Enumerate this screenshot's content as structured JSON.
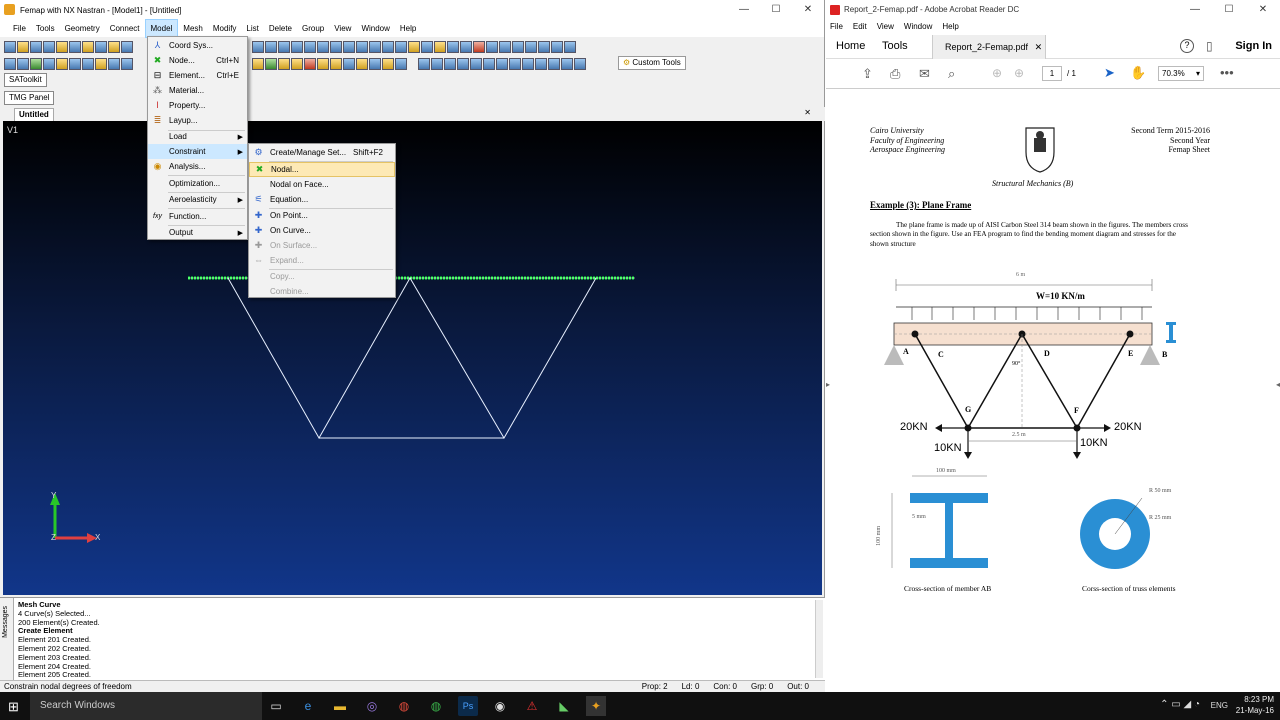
{
  "femap": {
    "title": "Femap with NX Nastran - [Model1] - [Untitled]",
    "menu": [
      "File",
      "Tools",
      "Geometry",
      "Connect",
      "Model",
      "Mesh",
      "Modify",
      "List",
      "Delete",
      "Group",
      "View",
      "Window",
      "Help"
    ],
    "panels": {
      "satoolkit": "SAToolkit",
      "tmg": "TMG Panel",
      "custom_tools": "Custom Tools"
    },
    "tab": "Untitled",
    "view_label": "V1",
    "model_menu": [
      {
        "label": "Coord Sys...",
        "shortcut": "",
        "icon": "coord-sys-icon"
      },
      {
        "label": "Node...",
        "shortcut": "Ctrl+N",
        "icon": "node-icon"
      },
      {
        "label": "Element...",
        "shortcut": "Ctrl+E",
        "icon": "element-icon"
      },
      {
        "label": "Material...",
        "shortcut": "",
        "icon": "material-icon"
      },
      {
        "label": "Property...",
        "shortcut": "",
        "icon": "property-icon"
      },
      {
        "label": "Layup...",
        "shortcut": "",
        "icon": "layup-icon"
      },
      {
        "label": "Load",
        "shortcut": "",
        "icon": ""
      },
      {
        "label": "Constraint",
        "shortcut": "",
        "icon": ""
      },
      {
        "label": "Analysis...",
        "shortcut": "",
        "icon": "analysis-icon"
      },
      {
        "label": "Optimization...",
        "shortcut": "",
        "icon": ""
      },
      {
        "label": "Aeroelasticity",
        "shortcut": "",
        "icon": ""
      },
      {
        "label": "Function...",
        "shortcut": "",
        "icon": "function-icon"
      },
      {
        "label": "Output",
        "shortcut": "",
        "icon": ""
      }
    ],
    "constraint_menu": [
      {
        "label": "Create/Manage Set...",
        "shortcut": "Shift+F2"
      },
      {
        "label": "Nodal...",
        "shortcut": ""
      },
      {
        "label": "Nodal on Face...",
        "shortcut": ""
      },
      {
        "label": "Equation...",
        "shortcut": ""
      },
      {
        "label": "On Point...",
        "shortcut": ""
      },
      {
        "label": "On Curve...",
        "shortcut": ""
      },
      {
        "label": "On Surface...",
        "shortcut": ""
      },
      {
        "label": "Expand...",
        "shortcut": ""
      },
      {
        "label": "Copy...",
        "shortcut": ""
      },
      {
        "label": "Combine...",
        "shortcut": ""
      }
    ],
    "messages_tab": "Messages",
    "messages": [
      "Mesh Curve",
      "4 Curve(s) Selected...",
      "200 Element(s) Created.",
      "Create Element",
      "Element 201 Created.",
      "Element 202 Created.",
      "Element 203 Created.",
      "Element 204 Created.",
      "Element 205 Created."
    ],
    "status": {
      "hint": "Constrain nodal degrees of freedom",
      "prop": "Prop: 2",
      "ld": "Ld: 0",
      "con": "Con: 0",
      "grp": "Grp: 0",
      "out": "Out: 0"
    },
    "axis": {
      "y": "Y",
      "x": "X",
      "z": "Z"
    }
  },
  "acrobat": {
    "title": "Report_2-Femap.pdf - Adobe Acrobat Reader DC",
    "menu": [
      "File",
      "Edit",
      "View",
      "Window",
      "Help"
    ],
    "home": "Home",
    "tools": "Tools",
    "doc_tab": "Report_2-Femap.pdf",
    "sign_in": "Sign In",
    "page_num": "1",
    "page_of": "/ 1",
    "zoom": "70.3%",
    "page": {
      "left_header": [
        "Cairo University",
        "Faculty of Engineering",
        "Aerospace Engineering"
      ],
      "right_header": [
        "Second Term 2015-2016",
        "Second Year",
        "Femap Sheet"
      ],
      "subtitle": "Structural   Mechanics   (B)",
      "example_title": "Example (3): Plane Frame",
      "paragraph": "The plane frame is made up of AISI Carbon Steel 314 beam shown in the figures. The members cross section shown in the figure. Use an FEA program to find the bending moment diagram and stresses for the shown structure",
      "dim_6m": "6 m",
      "load": "W=10 KN/m",
      "labels": {
        "A": "A",
        "B": "B",
        "C": "C",
        "D": "D",
        "E": "E",
        "F": "F",
        "G": "G"
      },
      "angle": "90°",
      "f20_left": "20KN",
      "f20_right": "20KN",
      "f10_left": "10KN",
      "f10_right": "10KN",
      "dim_25": "2.5 m",
      "i_width": "100 mm",
      "i_web": "5 mm",
      "i_height": "100 mm",
      "r50": "R 50 mm",
      "r25": "R 25 mm",
      "cap1": "Cross-section of member AB",
      "cap2": "Corss-section of truss elements"
    }
  },
  "taskbar": {
    "search": "Search Windows",
    "lang": "ENG",
    "time": "8:23 PM",
    "date": "21-May-16"
  }
}
